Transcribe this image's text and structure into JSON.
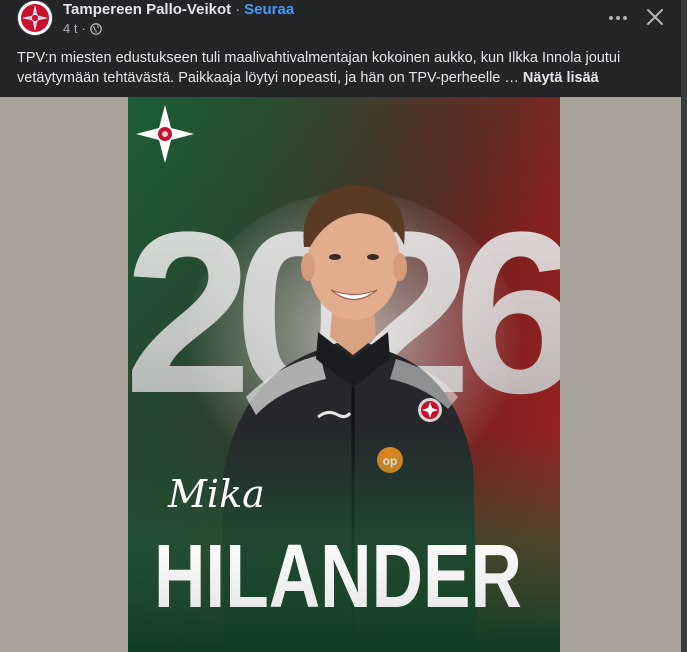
{
  "post": {
    "page_name": "Tampereen Pallo-Veikot",
    "separator": "·",
    "follow_label": "Seuraa",
    "time": "4 t",
    "meta_separator": "·",
    "privacy_icon": "globe-icon",
    "more_icon": "more-horizontal-icon",
    "close_icon": "close-icon",
    "text": "TPV:n miesten edustukseen tuli maalivahtivalmentajan kokoinen aukko, kun Ilkka Innola joutui vetäytymään tehtävästä. Paikkaaja löytyi nopeasti, ja hän on TPV-perheelle …",
    "see_more_label": "Näytä lisää"
  },
  "image": {
    "year": "2026",
    "first_name": "Mika",
    "last_name": "HILANDER",
    "colors": {
      "green": "#1e6b3c",
      "red": "#a11d1d",
      "page_bg": "#a8a29a"
    }
  }
}
